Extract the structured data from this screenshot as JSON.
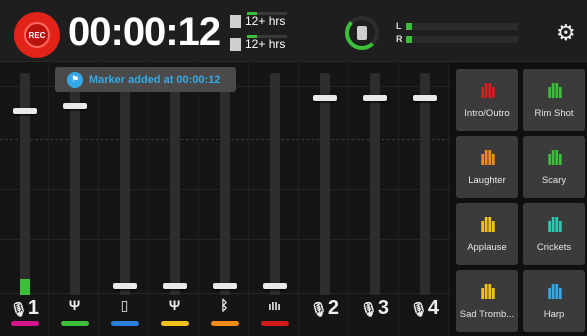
{
  "record": {
    "label": "REC"
  },
  "timer": "00:00:12",
  "storage": [
    {
      "icon": "sd-card-icon",
      "value": "12+ hrs"
    },
    {
      "icon": "usb-drive-icon",
      "value": "12+ hrs"
    }
  ],
  "output_meter": {
    "left_label": "L",
    "right_label": "R"
  },
  "toast": {
    "text": "Marker added at 00:00:12"
  },
  "channels": [
    {
      "label": "1",
      "icon": "mic-icon",
      "color": "#d4148a",
      "level": 0.84,
      "meter": 0.07
    },
    {
      "label": "",
      "icon": "usb-1-icon",
      "color": "#3bbf3b",
      "level": 0.86,
      "meter": 0
    },
    {
      "label": "",
      "icon": "phone-icon",
      "color": "#2a7fd9",
      "level": 0.03,
      "meter": 0
    },
    {
      "label": "",
      "icon": "usb-2-icon",
      "color": "#f2c21b",
      "level": 0.03,
      "meter": 0
    },
    {
      "label": "",
      "icon": "bluetooth-icon",
      "color": "#f48a1a",
      "level": 0.03,
      "meter": 0
    },
    {
      "label": "",
      "icon": "sound-pad-icon",
      "color": "#d41b1b",
      "level": 0.03,
      "meter": 0
    },
    {
      "label": "2",
      "icon": "mic-icon",
      "color": "",
      "level": 0.9,
      "meter": 0
    },
    {
      "label": "3",
      "icon": "mic-icon",
      "color": "",
      "level": 0.9,
      "meter": 0
    },
    {
      "label": "4",
      "icon": "mic-icon",
      "color": "",
      "level": 0.9,
      "meter": 0
    }
  ],
  "pads": [
    {
      "name": "Intro/Outro",
      "color": "#d91d1d"
    },
    {
      "name": "Rim Shot",
      "color": "#3bbf3b"
    },
    {
      "name": "Laughter",
      "color": "#f48a1a"
    },
    {
      "name": "Scary",
      "color": "#3bbf3b"
    },
    {
      "name": "Applause",
      "color": "#f2c21b"
    },
    {
      "name": "Crickets",
      "color": "#2ec9b0"
    },
    {
      "name": "Sad Tromb...",
      "color": "#f2c21b"
    },
    {
      "name": "Harp",
      "color": "#35a9e8"
    }
  ]
}
